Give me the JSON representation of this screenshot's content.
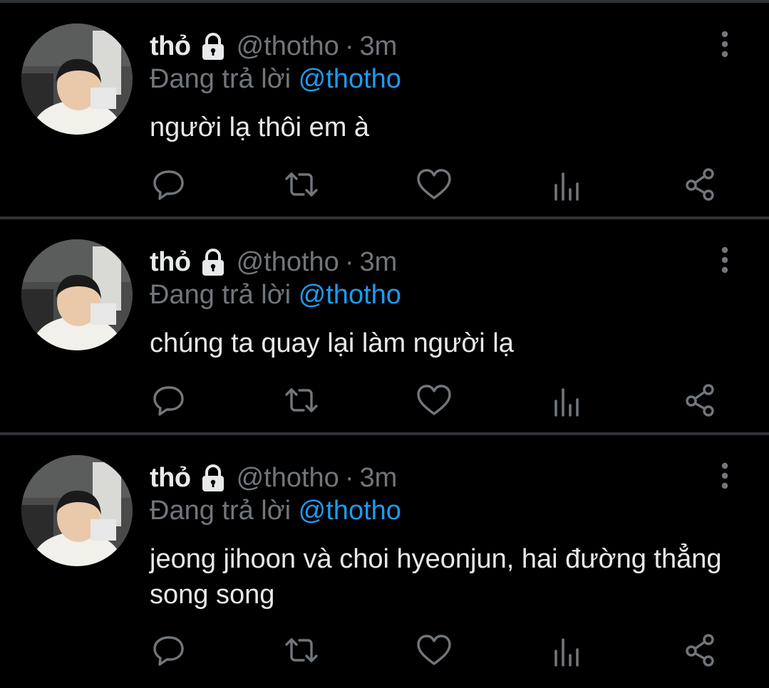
{
  "tweets": [
    {
      "name": "thỏ",
      "handle": "@thotho",
      "separator": "·",
      "time": "3m",
      "reply_prefix": "Đang trả lời",
      "reply_to": "@thotho",
      "text": "người lạ thôi em à"
    },
    {
      "name": "thỏ",
      "handle": "@thotho",
      "separator": "·",
      "time": "3m",
      "reply_prefix": "Đang trả lời",
      "reply_to": "@thotho",
      "text": "chúng ta quay lại làm người lạ"
    },
    {
      "name": "thỏ",
      "handle": "@thotho",
      "separator": "·",
      "time": "3m",
      "reply_prefix": "Đang trả lời",
      "reply_to": "@thotho",
      "text": "jeong jihoon và choi hyeonjun, hai đường thẳng song song"
    }
  ],
  "icons": {
    "lock": "lock-icon",
    "more": "more-vertical-icon",
    "reply": "reply-bubble-icon",
    "retweet": "retweet-icon",
    "like": "heart-icon",
    "views": "analytics-bars-icon",
    "share": "share-icon"
  },
  "colors": {
    "background": "#000000",
    "text": "#e7e9ea",
    "muted": "#71767b",
    "mention": "#1d9bf0",
    "divider": "#2f3336"
  }
}
